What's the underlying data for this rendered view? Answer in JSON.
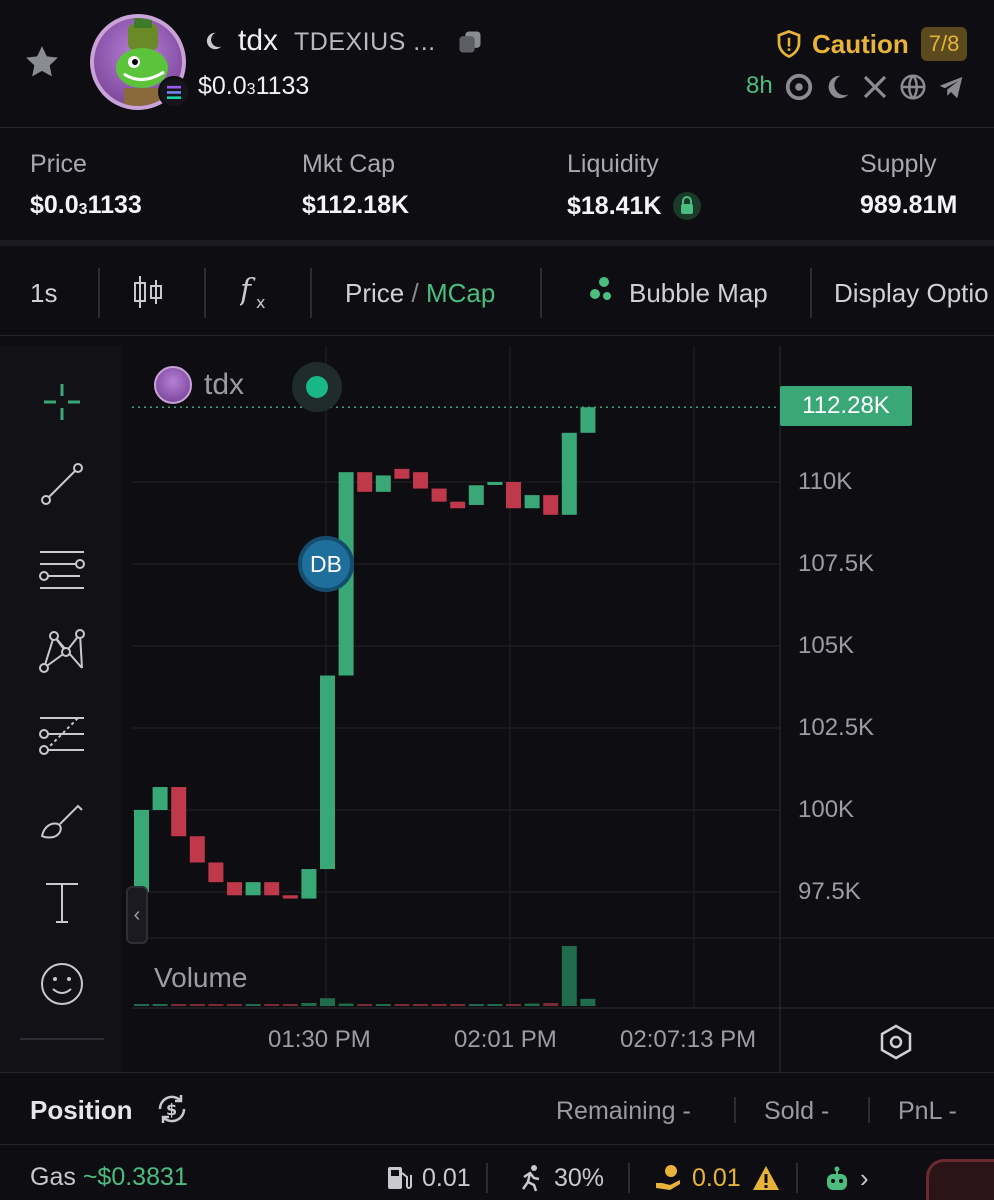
{
  "header": {
    "ticker": "tdx",
    "token_name": "TDEXIUS ...",
    "price_main": "$0.0",
    "price_sub": "3",
    "price_tail": "1133",
    "caution_label": "Caution",
    "caution_count": "7/8",
    "age": "8h",
    "social_icons": [
      "search-icon",
      "moon-icon",
      "x-logo-icon",
      "globe-icon",
      "telegram-icon"
    ]
  },
  "stats": {
    "price_label": "Price",
    "price_main": "$0.0",
    "price_sub": "3",
    "price_tail": "1133",
    "mcap_label": "Mkt Cap",
    "mcap_value": "$112.18K",
    "liquidity_label": "Liquidity",
    "liquidity_value": "$18.41K",
    "supply_label": "Supply",
    "supply_value": "989.81M"
  },
  "toolbar": {
    "interval": "1s",
    "price_label": "Price",
    "slash": "/",
    "mcap_label": "MCap",
    "bubble_label": "Bubble Map",
    "display_label": "Display Optio"
  },
  "chart": {
    "legend_name": "tdx",
    "current_value_label": "112.28K",
    "db_label": "DB",
    "volume_label": "Volume",
    "y_ticks": [
      "110K",
      "107.5K",
      "105K",
      "102.5K",
      "100K",
      "97.5K"
    ],
    "x_ticks": [
      "01:30 PM",
      "02:01 PM",
      "02:07:13 PM"
    ]
  },
  "chart_data": {
    "type": "candlestick",
    "title": "",
    "ylim": [
      96000,
      114000
    ],
    "y_ticks": [
      97500,
      100000,
      102500,
      105000,
      107500,
      110000
    ],
    "current_value": 112280,
    "colors": {
      "up": "#3aa876",
      "down": "#c0394a"
    },
    "candles": [
      {
        "o": 97500,
        "c": 100000,
        "up": true
      },
      {
        "o": 100000,
        "c": 100700,
        "up": true
      },
      {
        "o": 100700,
        "c": 99200,
        "up": false
      },
      {
        "o": 99200,
        "c": 98400,
        "up": false
      },
      {
        "o": 98400,
        "c": 97800,
        "up": false
      },
      {
        "o": 97800,
        "c": 97400,
        "up": false
      },
      {
        "o": 97400,
        "c": 97800,
        "up": true
      },
      {
        "o": 97800,
        "c": 97400,
        "up": false
      },
      {
        "o": 97400,
        "c": 97300,
        "up": false
      },
      {
        "o": 97300,
        "c": 98200,
        "up": true
      },
      {
        "o": 98200,
        "c": 104100,
        "up": true
      },
      {
        "o": 104100,
        "c": 110300,
        "up": true
      },
      {
        "o": 110300,
        "c": 109700,
        "up": false
      },
      {
        "o": 109700,
        "c": 110200,
        "up": true
      },
      {
        "o": 110400,
        "c": 110100,
        "up": false
      },
      {
        "o": 110300,
        "c": 109800,
        "up": false
      },
      {
        "o": 109800,
        "c": 109400,
        "up": false
      },
      {
        "o": 109400,
        "c": 109200,
        "up": false
      },
      {
        "o": 109300,
        "c": 109900,
        "up": true
      },
      {
        "o": 110000,
        "c": 110000,
        "up": true
      },
      {
        "o": 110000,
        "c": 109200,
        "up": false
      },
      {
        "o": 109200,
        "c": 109600,
        "up": true
      },
      {
        "o": 109600,
        "c": 109000,
        "up": false
      },
      {
        "o": 109000,
        "c": 111500,
        "up": true
      },
      {
        "o": 111500,
        "c": 112280,
        "up": true
      }
    ],
    "volume": [
      0.02,
      0.02,
      0.01,
      0.02,
      0.02,
      0.02,
      0.02,
      0.02,
      0.03,
      0.05,
      0.13,
      0.04,
      0.02,
      0.02,
      0.02,
      0.02,
      0.02,
      0.02,
      0.02,
      0.02,
      0.03,
      0.04,
      0.05,
      1.0,
      0.12
    ],
    "x_ticks": [
      "01:30 PM",
      "02:01 PM",
      "02:07:13 PM"
    ]
  },
  "position": {
    "title": "Position",
    "remaining": "Remaining -",
    "sold": "Sold -",
    "pnl": "PnL -"
  },
  "gas": {
    "label": "Gas",
    "value": "~$0.3831",
    "fuel_value": "0.01",
    "slippage": "30%",
    "tip_value": "0.01"
  }
}
